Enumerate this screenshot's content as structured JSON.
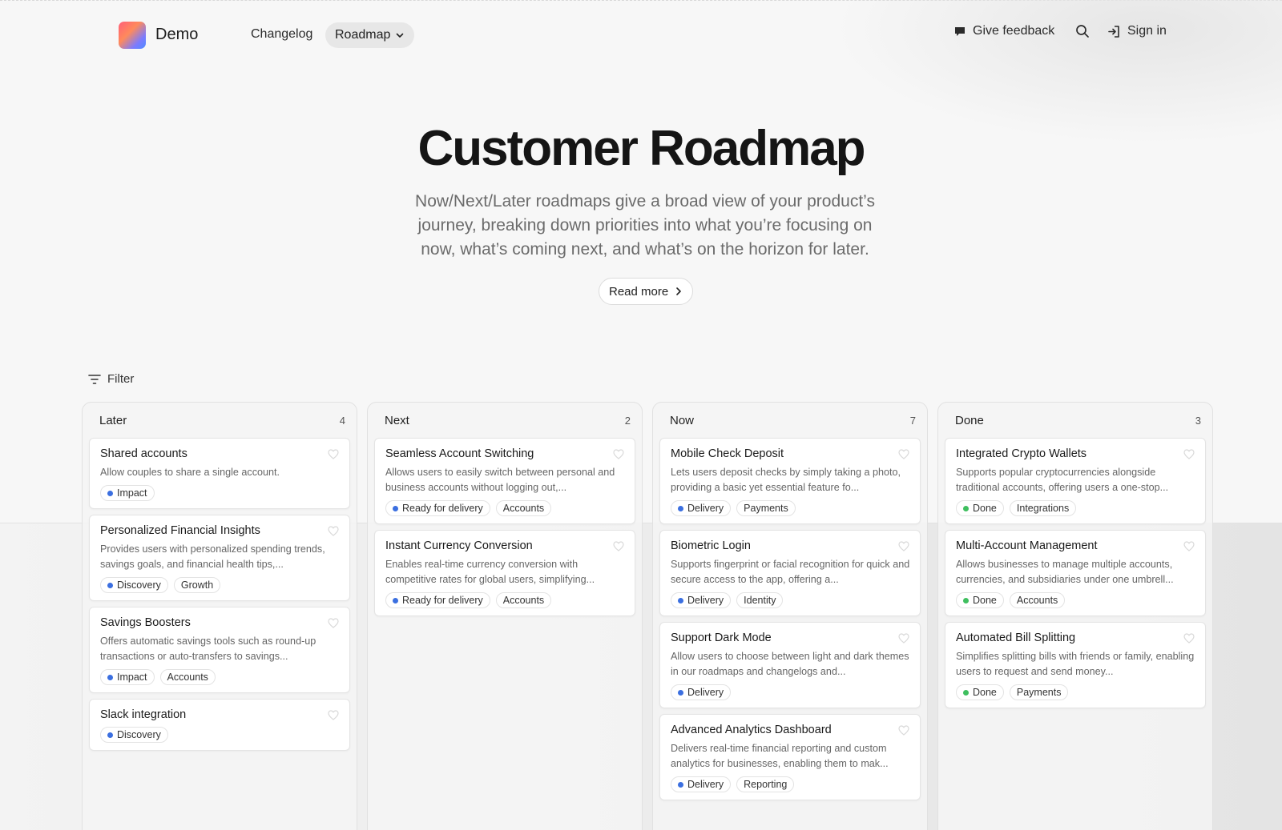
{
  "header": {
    "brand": "Demo",
    "nav": {
      "changelog": "Changelog",
      "roadmap": "Roadmap"
    },
    "feedback": "Give feedback",
    "sign_in": "Sign in"
  },
  "hero": {
    "title": "Customer Roadmap",
    "subtitle": "Now/Next/Later roadmaps give a broad view of your product’s journey, breaking down priorities into what you’re focusing on now, what’s coming next, and what’s on the horizon for later.",
    "read_more": "Read more"
  },
  "filter_label": "Filter",
  "colors": {
    "blue_dot": "#3b6fe0",
    "green_dot": "#3fbf5f"
  },
  "columns": [
    {
      "title": "Later",
      "count": "4",
      "cards": [
        {
          "title": "Shared accounts",
          "desc": "Allow couples to share a single account.",
          "tags": [
            {
              "label": "Impact",
              "dot": "blue"
            }
          ]
        },
        {
          "title": "Personalized Financial Insights",
          "desc": "Provides users with personalized spending trends, savings goals, and financial health tips,...",
          "tags": [
            {
              "label": "Discovery",
              "dot": "blue"
            },
            {
              "label": "Growth"
            }
          ]
        },
        {
          "title": "Savings Boosters",
          "desc": "Offers automatic savings tools such as round-up transactions or auto-transfers to savings...",
          "tags": [
            {
              "label": "Impact",
              "dot": "blue"
            },
            {
              "label": "Accounts"
            }
          ]
        },
        {
          "title": "Slack integration",
          "desc": "",
          "tags": [
            {
              "label": "Discovery",
              "dot": "blue"
            }
          ]
        }
      ]
    },
    {
      "title": "Next",
      "count": "2",
      "cards": [
        {
          "title": "Seamless Account Switching",
          "desc": "Allows users to easily switch between personal and business accounts without logging out,...",
          "tags": [
            {
              "label": "Ready for delivery",
              "dot": "blue"
            },
            {
              "label": "Accounts"
            }
          ]
        },
        {
          "title": "Instant Currency Conversion",
          "desc": "Enables real-time currency conversion with competitive rates for global users, simplifying...",
          "tags": [
            {
              "label": "Ready for delivery",
              "dot": "blue"
            },
            {
              "label": "Accounts"
            }
          ]
        }
      ]
    },
    {
      "title": "Now",
      "count": "7",
      "cards": [
        {
          "title": "Mobile Check Deposit",
          "desc": "Lets users deposit checks by simply taking a photo, providing a basic yet essential feature fo...",
          "tags": [
            {
              "label": "Delivery",
              "dot": "blue"
            },
            {
              "label": "Payments"
            }
          ]
        },
        {
          "title": "Biometric Login",
          "desc": "Supports fingerprint or facial recognition for quick and secure access to the app, offering a...",
          "tags": [
            {
              "label": "Delivery",
              "dot": "blue"
            },
            {
              "label": "Identity"
            }
          ]
        },
        {
          "title": "Support Dark Mode",
          "desc": "Allow users to choose between light and dark themes in our roadmaps and changelogs and...",
          "tags": [
            {
              "label": "Delivery",
              "dot": "blue"
            }
          ]
        },
        {
          "title": "Advanced Analytics Dashboard",
          "desc": "Delivers real-time financial reporting and custom analytics for businesses, enabling them to mak...",
          "tags": [
            {
              "label": "Delivery",
              "dot": "blue"
            },
            {
              "label": "Reporting"
            }
          ]
        }
      ]
    },
    {
      "title": "Done",
      "count": "3",
      "cards": [
        {
          "title": "Integrated Crypto Wallets",
          "desc": "Supports popular cryptocurrencies alongside traditional accounts, offering users a one-stop...",
          "tags": [
            {
              "label": "Done",
              "dot": "green"
            },
            {
              "label": "Integrations"
            }
          ]
        },
        {
          "title": "Multi-Account Management",
          "desc": "Allows businesses to manage multiple accounts, currencies, and subsidiaries under one umbrell...",
          "tags": [
            {
              "label": "Done",
              "dot": "green"
            },
            {
              "label": "Accounts"
            }
          ]
        },
        {
          "title": "Automated Bill Splitting",
          "desc": "Simplifies splitting bills with friends or family, enabling users to request and send money...",
          "tags": [
            {
              "label": "Done",
              "dot": "green"
            },
            {
              "label": "Payments"
            }
          ]
        }
      ]
    }
  ]
}
